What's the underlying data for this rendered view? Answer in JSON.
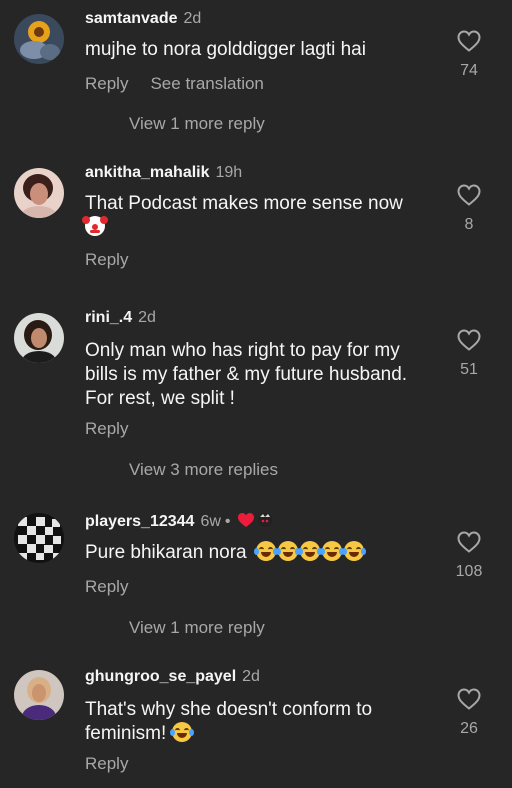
{
  "comments": [
    {
      "username": "samtanvade",
      "time": "2d",
      "text": "mujhe to nora golddigger lagti hai",
      "reply_label": "Reply",
      "translate_label": "See translation",
      "likes": "74",
      "more_replies": "View 1 more reply"
    },
    {
      "username": "ankitha_mahalik",
      "time": "19h",
      "text": "That Podcast makes more sense now",
      "reply_label": "Reply",
      "likes": "8"
    },
    {
      "username": "rini_.4",
      "time": "2d",
      "text_lines": [
        "Only man who has right to pay for my",
        "bills is my father & my future husband.",
        "For rest, we split !"
      ],
      "reply_label": "Reply",
      "likes": "51",
      "more_replies": "View 3 more replies"
    },
    {
      "username": "players_12344",
      "time": "6w",
      "dot": "•",
      "text": "Pure bhikaran nora",
      "reply_label": "Reply",
      "likes": "108",
      "more_replies": "View 1 more reply"
    },
    {
      "username": "ghungroo_se_payel",
      "time": "2d",
      "text_lines": [
        "That's why she doesn't conform to",
        "feminism!"
      ],
      "reply_label": "Reply",
      "likes": "26"
    }
  ],
  "icons": {
    "like": "heart-outline-icon",
    "creator_like": "red-heart-icon",
    "laughing": "face-with-tears-of-joy-emoji",
    "clown": "clown-face-emoji"
  },
  "colors": {
    "background": "#262626",
    "primary_text": "#f5f5f5",
    "secondary_text": "#a8a8a8",
    "heart_red": "#ed1c3a"
  }
}
